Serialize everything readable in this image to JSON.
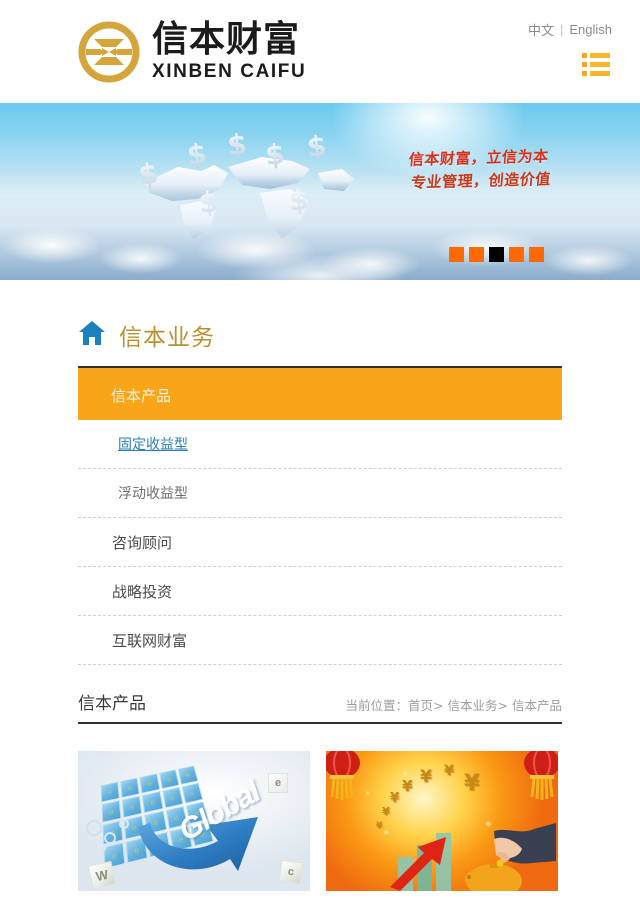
{
  "header": {
    "logo": {
      "icon": "xinben-circle-logo",
      "brand_cn": "信本财富",
      "brand_en": "XINBEN CAIFU",
      "gold": "#d4a53a"
    },
    "lang": {
      "zh": "中文",
      "separator": "|",
      "en": "English"
    },
    "menu_icon": "list-menu-icon"
  },
  "banner": {
    "slogan_line1": "信本财富，立信为本",
    "slogan_line2": "专业管理，创造价值",
    "slogan_color": "#d7301b",
    "dots": [
      {
        "label": "1",
        "active": false
      },
      {
        "label": "2",
        "active": false
      },
      {
        "label": "3",
        "active": true
      },
      {
        "label": "4",
        "active": false
      },
      {
        "label": "5",
        "active": false
      }
    ],
    "dot_color": "#ff6a00",
    "dot_active_color": "#000000",
    "artwork": "world-map-with-dollar-signs-above-clouds"
  },
  "section": {
    "home_icon": "home-icon",
    "home_icon_color": "#1a80be",
    "title": "信本业务",
    "title_color": "#b8902f",
    "accent_color": "#f5a623"
  },
  "nav": {
    "items": [
      {
        "label": "信本产品",
        "state": "active"
      },
      {
        "label": "固定收益型",
        "state": "sub-active"
      },
      {
        "label": "浮动收益型",
        "state": "sub"
      },
      {
        "label": "咨询顾问",
        "state": "normal"
      },
      {
        "label": "战略投资",
        "state": "normal"
      },
      {
        "label": "互联网财富",
        "state": "normal"
      }
    ],
    "active_bg": "#f9a51a",
    "sub_active_color": "#2a7fb8"
  },
  "breadcrumb": {
    "page_title": "信本产品",
    "prefix": "当前位置：",
    "trail": [
      "首页",
      "信本业务",
      "信本产品"
    ],
    "separator": ">",
    "full_path": "当前位置： 首页> 信本业务> 信本产品"
  },
  "products": [
    {
      "artwork": "blue-global-cube-with-arrow",
      "word": "Global",
      "cell_char": "e",
      "block_w": "W",
      "block_e": "e",
      "block_c": "c"
    },
    {
      "artwork": "festive-growth-chart-with-lanterns-and-piggy-bank",
      "yen": "¥"
    }
  ]
}
